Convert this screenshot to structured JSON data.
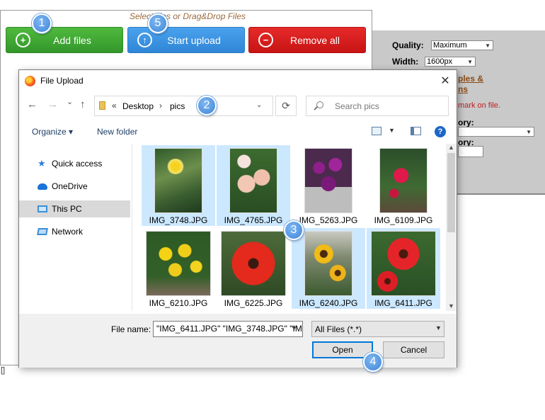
{
  "webpage": {
    "drop_hint": "Select files or Drag&Drop Files",
    "buttons": {
      "add_files": "Add files",
      "start_upload": "Start upload",
      "remove_all": "Remove all"
    },
    "options": {
      "quality_label": "Quality:",
      "quality_value": "Maximum",
      "width_label": "Width:",
      "width_value": "1600px",
      "link_line1": "ples &",
      "link_line2": "ns",
      "note": "mark on file.",
      "category_label": "ory:",
      "category2_label": "ory:"
    },
    "colors": {
      "add": "#3aa52f",
      "upload": "#3a95e4",
      "remove": "#d91b1b",
      "panel": "#c9c9c9"
    }
  },
  "dialog": {
    "title": "File Upload",
    "close_glyph": "✕",
    "nav": {
      "back": "←",
      "forward": "→",
      "recent": "⌄",
      "up": "↑"
    },
    "address": {
      "prefix": "«",
      "crumbs": [
        "Desktop",
        "pics"
      ],
      "sep": "›"
    },
    "search_placeholder": "Search pics",
    "toolbar": {
      "organize": "Organize ▾",
      "new_folder": "New folder"
    },
    "nav_items": [
      {
        "label": "Quick access",
        "icon": "star-icon",
        "color": "#2f7de1"
      },
      {
        "label": "OneDrive",
        "icon": "cloud-icon",
        "color": "#1a73d9"
      },
      {
        "label": "This PC",
        "icon": "computer-icon",
        "color": "#3d8fd6"
      },
      {
        "label": "Network",
        "icon": "network-icon",
        "color": "#3d8fd6"
      }
    ],
    "files": [
      {
        "name": "IMG_3748.JPG",
        "selected": true
      },
      {
        "name": "IMG_4765.JPG",
        "selected": true
      },
      {
        "name": "IMG_5263.JPG",
        "selected": false
      },
      {
        "name": "IMG_6109.JPG",
        "selected": false
      },
      {
        "name": "IMG_6210.JPG",
        "selected": false
      },
      {
        "name": "IMG_6225.JPG",
        "selected": false
      },
      {
        "name": "IMG_6240.JPG",
        "selected": true
      },
      {
        "name": "IMG_6411.JPG",
        "selected": true
      }
    ],
    "file_name_label": "File name:",
    "file_name_value": "\"IMG_6411.JPG\" \"IMG_3748.JPG\" \"IMG",
    "file_type": "All Files (*.*)",
    "open": "Open",
    "cancel": "Cancel"
  },
  "steps": [
    "1",
    "2",
    "3",
    "4",
    "5"
  ],
  "misc": {
    "stray_bracket": "[]"
  }
}
